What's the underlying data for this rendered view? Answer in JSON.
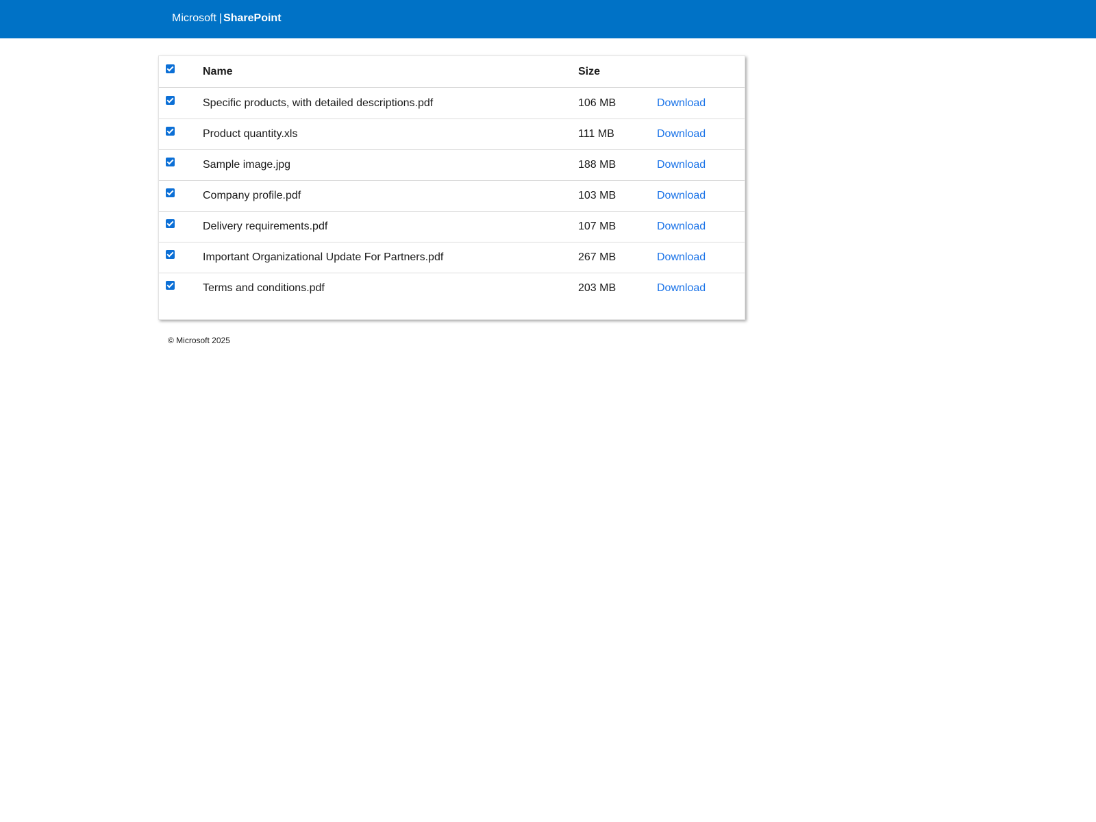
{
  "header": {
    "brand_company": "Microsoft",
    "brand_separator": "|",
    "brand_product": "SharePoint",
    "background_color": "#0072c6"
  },
  "table": {
    "columns": {
      "name": "Name",
      "size": "Size"
    },
    "select_all_checked": true,
    "rows": [
      {
        "name": "Specific products, with detailed descriptions.pdf",
        "size": "106 MB",
        "action": "Download",
        "checked": true
      },
      {
        "name": "Product quantity.xls",
        "size": "111 MB",
        "action": "Download",
        "checked": true
      },
      {
        "name": "Sample image.jpg",
        "size": "188 MB",
        "action": "Download",
        "checked": true
      },
      {
        "name": "Company profile.pdf",
        "size": "103 MB",
        "action": "Download",
        "checked": true
      },
      {
        "name": "Delivery requirements.pdf",
        "size": "107 MB",
        "action": "Download",
        "checked": true
      },
      {
        "name": "Important Organizational Update For Partners.pdf",
        "size": "267 MB",
        "action": "Download",
        "checked": true
      },
      {
        "name": "Terms and conditions.pdf",
        "size": "203 MB",
        "action": "Download",
        "checked": true
      }
    ],
    "link_color": "#1a73e8",
    "checkbox_color": "#0b6fd6"
  },
  "footer": {
    "copyright": "© Microsoft 2025"
  }
}
